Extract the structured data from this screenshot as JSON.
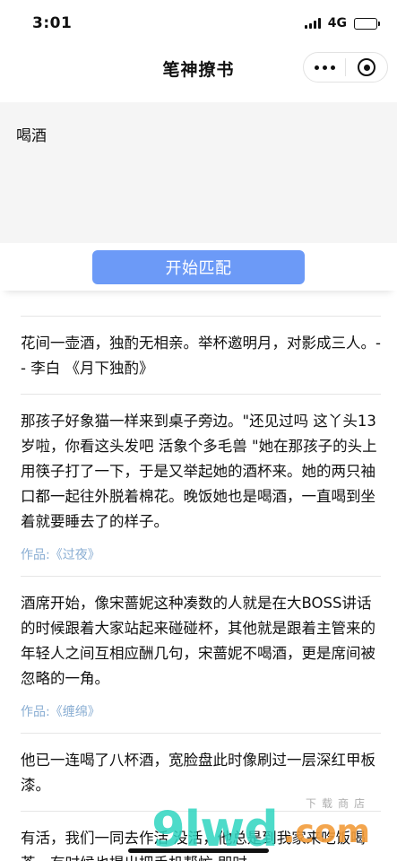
{
  "status_bar": {
    "time": "3:01",
    "network": "4G"
  },
  "nav": {
    "title": "笔神撩书"
  },
  "search": {
    "query": "喝酒"
  },
  "match_button": {
    "label": "开始匹配"
  },
  "results": [
    {
      "text": "花间一壶酒，独酌无相亲。举杯邀明月，对影成三人。-- 李白 《月下独酌》",
      "work": ""
    },
    {
      "text": "那孩子好象猫一样来到桌子旁边。\"还见过吗 这丫头13岁啦，你看这头发吧 活象个多毛兽 \"她在那孩子的头上用筷子打了一下，于是又举起她的酒杯来。她的两只袖口都一起往外脱着棉花。晚饭她也是喝酒，一直喝到坐着就要睡去了的样子。",
      "work": "作品:《过夜》"
    },
    {
      "text": "酒席开始，像宋蔷妮这种凑数的人就是在大BOSS讲话的时候跟着大家站起来碰碰杯，其他就是跟着主管来的年轻人之间互相应酬几句，宋蔷妮不喝酒，更是席间被忽略的一角。",
      "work": "作品:《缠绵》"
    },
    {
      "text": "他已一连喝了八杯酒，宽脸盘此时像刷过一层深红甲板漆。",
      "work": ""
    },
    {
      "text": "有活，我们一同去作活 没活，他总是到我家来吃饭喝茶，有时候也提出把手机帮忙 即时",
      "work": ""
    }
  ],
  "watermark": {
    "main": "9lwd",
    "suffix": ".com",
    "small": "下载商店"
  }
}
